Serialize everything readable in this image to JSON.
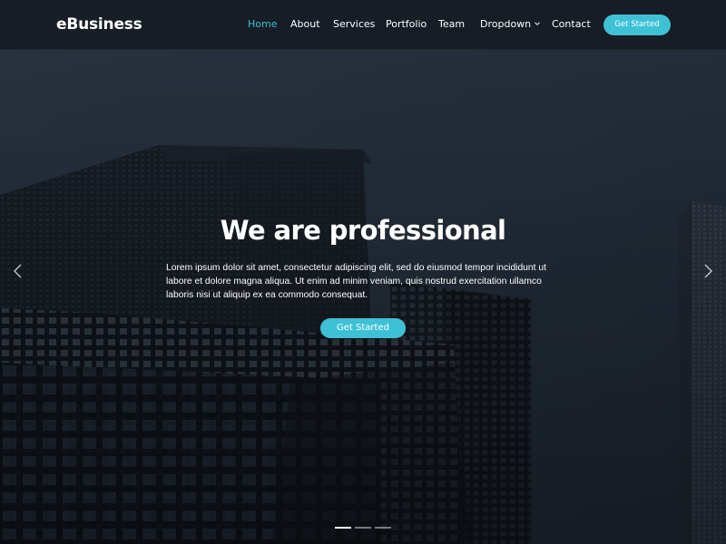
{
  "header": {
    "logo": "eBusiness",
    "nav": [
      {
        "label": "Home",
        "active": true
      },
      {
        "label": "About"
      },
      {
        "label": "Services"
      },
      {
        "label": "Portfolio"
      },
      {
        "label": "Team"
      },
      {
        "label": "Dropdown",
        "icon": "chevron-down-icon"
      },
      {
        "label": "Contact"
      }
    ],
    "cta_label": "Get Started"
  },
  "hero": {
    "title": "We are professional",
    "text": "Lorem ipsum dolor sit amet, consectetur adipiscing elit, sed do eiusmod tempor incididunt ut labore et dolore magna aliqua. Ut enim ad minim veniam, quis nostrud exercitation ullamco laboris nisi ut aliquip ex ea commodo consequat.",
    "cta_label": "Get Started"
  },
  "carousel": {
    "slide_count": 3,
    "active_index": 0,
    "prev_icon": "chevron-left-icon",
    "next_icon": "chevron-right-icon"
  },
  "colors": {
    "accent": "#3ec1d5",
    "header_bg": "#161c24",
    "text": "#ffffff"
  }
}
